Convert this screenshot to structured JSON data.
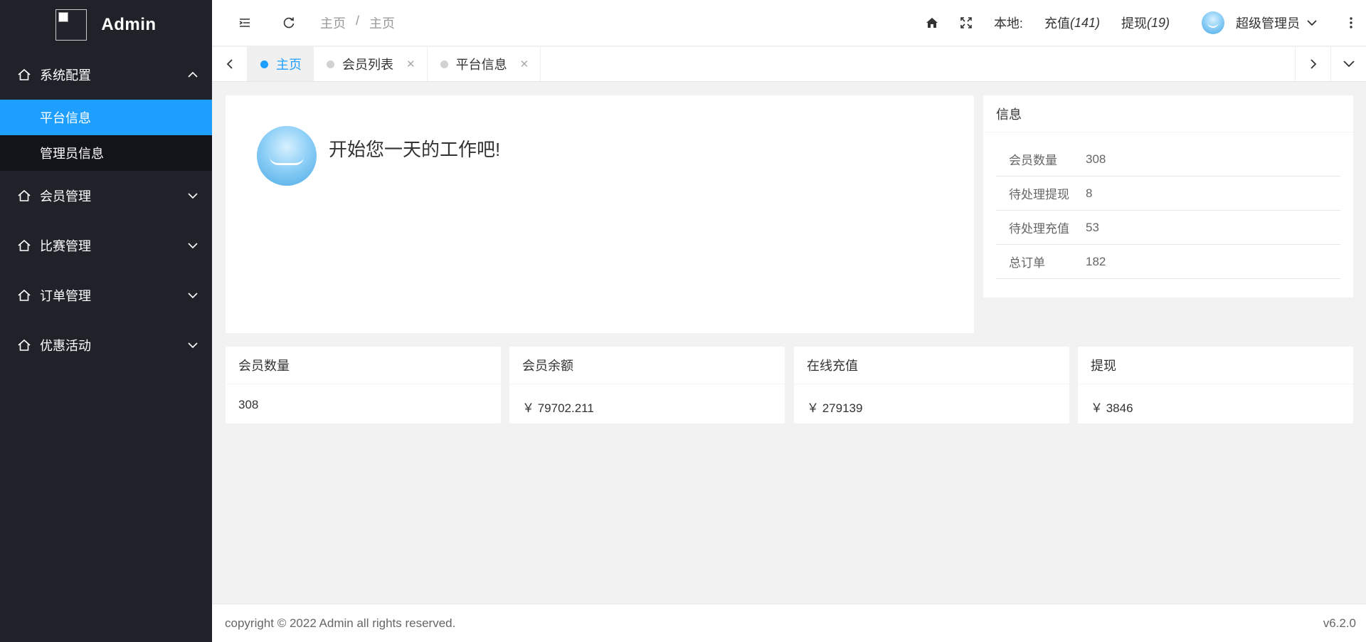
{
  "sidebar": {
    "logo_text": "Admin",
    "groups": [
      {
        "label": "系统配置",
        "icon": "home-icon",
        "expanded": true,
        "items": [
          {
            "label": "平台信息",
            "active": true
          },
          {
            "label": "管理员信息",
            "active": false
          }
        ]
      },
      {
        "label": "会员管理",
        "icon": "home-icon",
        "expanded": false
      },
      {
        "label": "比赛管理",
        "icon": "home-icon",
        "expanded": false
      },
      {
        "label": "订单管理",
        "icon": "home-icon",
        "expanded": false
      },
      {
        "label": "优惠活动",
        "icon": "home-icon",
        "expanded": false
      }
    ]
  },
  "header": {
    "breadcrumb": [
      "主页",
      "/",
      "主页"
    ],
    "local_label": "本地:",
    "recharge_label": "充值",
    "recharge_count": "(141)",
    "withdraw_label": "提现",
    "withdraw_count": "(19)",
    "user_name": "超级管理员"
  },
  "tabs": [
    {
      "label": "主页",
      "active": true,
      "closable": false
    },
    {
      "label": "会员列表",
      "active": false,
      "closable": true
    },
    {
      "label": "平台信息",
      "active": false,
      "closable": true
    }
  ],
  "welcome": {
    "message": "开始您一天的工作吧!"
  },
  "info": {
    "title": "信息",
    "rows": [
      {
        "key": "会员数量",
        "value": "308"
      },
      {
        "key": "待处理提现",
        "value": "8"
      },
      {
        "key": "待处理充值",
        "value": "53"
      },
      {
        "key": "总订单",
        "value": "182"
      }
    ]
  },
  "stats": [
    {
      "title": "会员数量",
      "value": "308"
    },
    {
      "title": "会员余额",
      "value": "￥ 79702.211"
    },
    {
      "title": "在线充值",
      "value": "￥ 279139"
    },
    {
      "title": "提现",
      "value": "￥ 3846"
    }
  ],
  "footer": {
    "copyright": "copyright © 2022 Admin all rights reserved.",
    "version": "v6.2.0"
  },
  "colors": {
    "sidebar_bg": "#20222a",
    "accent": "#1e9fff",
    "page_bg": "#f2f2f2"
  }
}
